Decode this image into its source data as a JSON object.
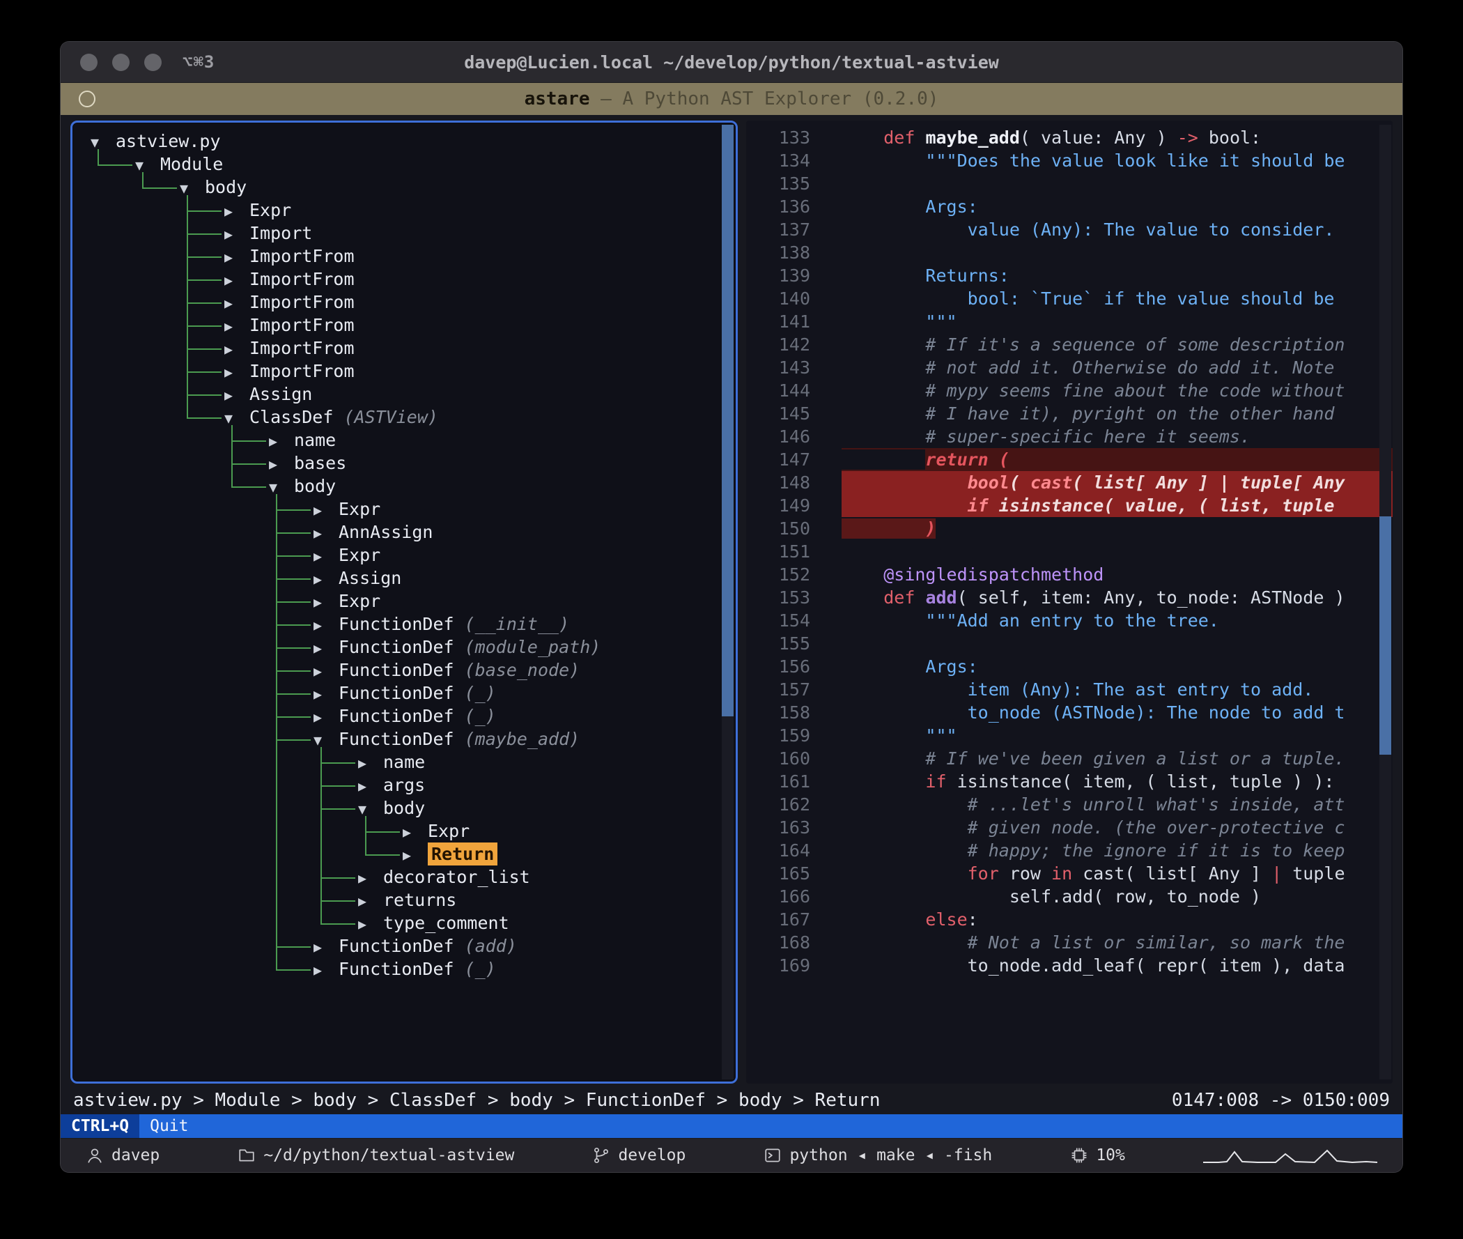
{
  "titlebar": {
    "shortcut": "⌥⌘3",
    "title": "davep@Lucien.local ~/develop/python/textual-astview"
  },
  "app_header": {
    "name": "astare",
    "separator": " — ",
    "subtitle": "A Python AST Explorer (0.2.0)"
  },
  "tree": {
    "rows": [
      {
        "d": 0,
        "a": "open",
        "label": "astview.py"
      },
      {
        "d": 1,
        "a": "open",
        "label": "Module"
      },
      {
        "d": 2,
        "a": "open",
        "label": "body"
      },
      {
        "d": 3,
        "a": "closed",
        "label": "Expr"
      },
      {
        "d": 3,
        "a": "closed",
        "label": "Import"
      },
      {
        "d": 3,
        "a": "closed",
        "label": "ImportFrom"
      },
      {
        "d": 3,
        "a": "closed",
        "label": "ImportFrom"
      },
      {
        "d": 3,
        "a": "closed",
        "label": "ImportFrom"
      },
      {
        "d": 3,
        "a": "closed",
        "label": "ImportFrom"
      },
      {
        "d": 3,
        "a": "closed",
        "label": "ImportFrom"
      },
      {
        "d": 3,
        "a": "closed",
        "label": "ImportFrom"
      },
      {
        "d": 3,
        "a": "closed",
        "label": "Assign"
      },
      {
        "d": 3,
        "a": "open",
        "label": "ClassDef",
        "extra": "(ASTView)"
      },
      {
        "d": 4,
        "a": "closed",
        "label": "name"
      },
      {
        "d": 4,
        "a": "closed",
        "label": "bases"
      },
      {
        "d": 4,
        "a": "open",
        "label": "body"
      },
      {
        "d": 5,
        "a": "closed",
        "label": "Expr"
      },
      {
        "d": 5,
        "a": "closed",
        "label": "AnnAssign"
      },
      {
        "d": 5,
        "a": "closed",
        "label": "Expr"
      },
      {
        "d": 5,
        "a": "closed",
        "label": "Assign"
      },
      {
        "d": 5,
        "a": "closed",
        "label": "Expr"
      },
      {
        "d": 5,
        "a": "closed",
        "label": "FunctionDef",
        "extra": "(__init__)"
      },
      {
        "d": 5,
        "a": "closed",
        "label": "FunctionDef",
        "extra": "(module_path)"
      },
      {
        "d": 5,
        "a": "closed",
        "label": "FunctionDef",
        "extra": "(base_node)"
      },
      {
        "d": 5,
        "a": "closed",
        "label": "FunctionDef",
        "extra": "(_)"
      },
      {
        "d": 5,
        "a": "closed",
        "label": "FunctionDef",
        "extra": "(_)"
      },
      {
        "d": 5,
        "a": "open",
        "label": "FunctionDef",
        "extra": "(maybe_add)"
      },
      {
        "d": 6,
        "a": "closed",
        "label": "name"
      },
      {
        "d": 6,
        "a": "closed",
        "label": "args"
      },
      {
        "d": 6,
        "a": "open",
        "label": "body"
      },
      {
        "d": 7,
        "a": "closed",
        "label": "Expr"
      },
      {
        "d": 7,
        "a": "closed",
        "label": "Return",
        "selected": true
      },
      {
        "d": 6,
        "a": "closed",
        "label": "decorator_list"
      },
      {
        "d": 6,
        "a": "closed",
        "label": "returns"
      },
      {
        "d": 6,
        "a": "closed",
        "label": "type_comment"
      },
      {
        "d": 5,
        "a": "closed",
        "label": "FunctionDef",
        "extra": "(add)"
      },
      {
        "d": 5,
        "a": "closed",
        "label": "FunctionDef",
        "extra": "(_)"
      }
    ]
  },
  "code": {
    "lines": [
      {
        "n": 133,
        "s": [
          {
            "t": "    ",
            "c": "t"
          },
          {
            "t": "def",
            "c": "k"
          },
          {
            "t": " ",
            "c": "t"
          },
          {
            "t": "maybe_add",
            "c": "f"
          },
          {
            "t": "( value: Any ) ",
            "c": "t"
          },
          {
            "t": "->",
            "c": "k"
          },
          {
            "t": " bool:",
            "c": "t"
          }
        ]
      },
      {
        "n": 134,
        "s": [
          {
            "t": "        ",
            "c": "t"
          },
          {
            "t": "\"\"\"Does the value look like it should be",
            "c": "s"
          }
        ]
      },
      {
        "n": 135,
        "s": []
      },
      {
        "n": 136,
        "s": [
          {
            "t": "        ",
            "c": "t"
          },
          {
            "t": "Args:",
            "c": "s"
          }
        ]
      },
      {
        "n": 137,
        "s": [
          {
            "t": "            ",
            "c": "t"
          },
          {
            "t": "value (Any): The value to consider.",
            "c": "s"
          }
        ]
      },
      {
        "n": 138,
        "s": []
      },
      {
        "n": 139,
        "s": [
          {
            "t": "        ",
            "c": "t"
          },
          {
            "t": "Returns:",
            "c": "s"
          }
        ]
      },
      {
        "n": 140,
        "s": [
          {
            "t": "            ",
            "c": "t"
          },
          {
            "t": "bool: `True` if the value should be",
            "c": "s"
          }
        ]
      },
      {
        "n": 141,
        "s": [
          {
            "t": "        ",
            "c": "t"
          },
          {
            "t": "\"\"\"",
            "c": "s"
          }
        ]
      },
      {
        "n": 142,
        "s": [
          {
            "t": "        ",
            "c": "t"
          },
          {
            "t": "# If it's a sequence of some description",
            "c": "c"
          }
        ]
      },
      {
        "n": 143,
        "s": [
          {
            "t": "        ",
            "c": "t"
          },
          {
            "t": "# not add it. Otherwise do add it. Note",
            "c": "c"
          }
        ]
      },
      {
        "n": 144,
        "s": [
          {
            "t": "        ",
            "c": "t"
          },
          {
            "t": "# mypy seems fine about the code without",
            "c": "c"
          }
        ]
      },
      {
        "n": 145,
        "s": [
          {
            "t": "        ",
            "c": "t"
          },
          {
            "t": "# I have it), pyright on the other hand",
            "c": "c"
          }
        ]
      },
      {
        "n": 146,
        "s": [
          {
            "t": "        ",
            "c": "t"
          },
          {
            "t": "# super-specific here it seems.",
            "c": "c"
          }
        ]
      },
      {
        "n": 147,
        "hl": "dim",
        "s": [
          {
            "t": "        ",
            "c": "t"
          },
          {
            "t": "return (",
            "c": "rk"
          }
        ]
      },
      {
        "n": 148,
        "hl": "full",
        "s": [
          {
            "t": "            ",
            "c": "hb"
          },
          {
            "t": "bool",
            "c": "hk"
          },
          {
            "t": "( ",
            "c": "hb"
          },
          {
            "t": "cast",
            "c": "hk"
          },
          {
            "t": "( list[ Any ] | tuple[ Any",
            "c": "hb"
          }
        ]
      },
      {
        "n": 149,
        "hl": "full",
        "s": [
          {
            "t": "            ",
            "c": "hb"
          },
          {
            "t": "if",
            "c": "hk"
          },
          {
            "t": " isinstance( value, ( list, tuple",
            "c": "hb"
          }
        ]
      },
      {
        "n": 150,
        "hl": "tail",
        "s": [
          {
            "t": "        ",
            "c": "t"
          },
          {
            "t": ")",
            "c": "rk"
          }
        ]
      },
      {
        "n": 151,
        "s": []
      },
      {
        "n": 152,
        "s": [
          {
            "t": "    ",
            "c": "t"
          },
          {
            "t": "@singledispatchmethod",
            "c": "d"
          }
        ]
      },
      {
        "n": 153,
        "s": [
          {
            "t": "    ",
            "c": "t"
          },
          {
            "t": "def",
            "c": "k"
          },
          {
            "t": " ",
            "c": "t"
          },
          {
            "t": "add",
            "c": "p"
          },
          {
            "t": "( self, item: Any, to_node: ASTNode )",
            "c": "t"
          }
        ]
      },
      {
        "n": 154,
        "s": [
          {
            "t": "        ",
            "c": "t"
          },
          {
            "t": "\"\"\"Add an entry to the tree.",
            "c": "s"
          }
        ]
      },
      {
        "n": 155,
        "s": []
      },
      {
        "n": 156,
        "s": [
          {
            "t": "        ",
            "c": "t"
          },
          {
            "t": "Args:",
            "c": "s"
          }
        ]
      },
      {
        "n": 157,
        "s": [
          {
            "t": "            ",
            "c": "t"
          },
          {
            "t": "item (Any): The ast entry to add.",
            "c": "s"
          }
        ]
      },
      {
        "n": 158,
        "s": [
          {
            "t": "            ",
            "c": "t"
          },
          {
            "t": "to_node (ASTNode): The node to add t",
            "c": "s"
          }
        ]
      },
      {
        "n": 159,
        "s": [
          {
            "t": "        ",
            "c": "t"
          },
          {
            "t": "\"\"\"",
            "c": "s"
          }
        ]
      },
      {
        "n": 160,
        "s": [
          {
            "t": "        ",
            "c": "t"
          },
          {
            "t": "# If we've been given a list or a tuple.",
            "c": "c"
          }
        ]
      },
      {
        "n": 161,
        "s": [
          {
            "t": "        ",
            "c": "t"
          },
          {
            "t": "if",
            "c": "k"
          },
          {
            "t": " isinstance( item, ( list, tuple ) ):",
            "c": "t"
          }
        ]
      },
      {
        "n": 162,
        "s": [
          {
            "t": "            ",
            "c": "t"
          },
          {
            "t": "# ...let's unroll what's inside, att",
            "c": "c"
          }
        ]
      },
      {
        "n": 163,
        "s": [
          {
            "t": "            ",
            "c": "t"
          },
          {
            "t": "# given node. (the over-protective c",
            "c": "c"
          }
        ]
      },
      {
        "n": 164,
        "s": [
          {
            "t": "            ",
            "c": "t"
          },
          {
            "t": "# happy; the ignore if it is to keep",
            "c": "c"
          }
        ]
      },
      {
        "n": 165,
        "s": [
          {
            "t": "            ",
            "c": "t"
          },
          {
            "t": "for",
            "c": "k"
          },
          {
            "t": " row ",
            "c": "t"
          },
          {
            "t": "in",
            "c": "k"
          },
          {
            "t": " cast( list[ Any ] ",
            "c": "t"
          },
          {
            "t": "|",
            "c": "k"
          },
          {
            "t": " tuple",
            "c": "t"
          }
        ]
      },
      {
        "n": 166,
        "s": [
          {
            "t": "                ",
            "c": "t"
          },
          {
            "t": "self.add( row, to_node )",
            "c": "t"
          }
        ]
      },
      {
        "n": 167,
        "s": [
          {
            "t": "        ",
            "c": "t"
          },
          {
            "t": "else",
            "c": "k"
          },
          {
            "t": ":",
            "c": "t"
          }
        ]
      },
      {
        "n": 168,
        "s": [
          {
            "t": "            ",
            "c": "t"
          },
          {
            "t": "# Not a list or similar, so mark the",
            "c": "c"
          }
        ]
      },
      {
        "n": 169,
        "s": [
          {
            "t": "            ",
            "c": "t"
          },
          {
            "t": "to_node.add_leaf( repr( item ), data",
            "c": "t"
          }
        ]
      }
    ]
  },
  "breadcrumb": {
    "path": [
      "astview.py",
      "Module",
      "body",
      "ClassDef",
      "body",
      "FunctionDef",
      "body",
      "Return"
    ],
    "separator": ">",
    "position": "0147:008 -> 0150:009"
  },
  "footer": {
    "key": "CTRL+Q",
    "action": "Quit"
  },
  "statusbar": {
    "user": "davep",
    "path": "~/d/python/textual-astview",
    "branch": "develop",
    "processes": "python ◂ make ◂ -fish",
    "cpu": "10%"
  }
}
